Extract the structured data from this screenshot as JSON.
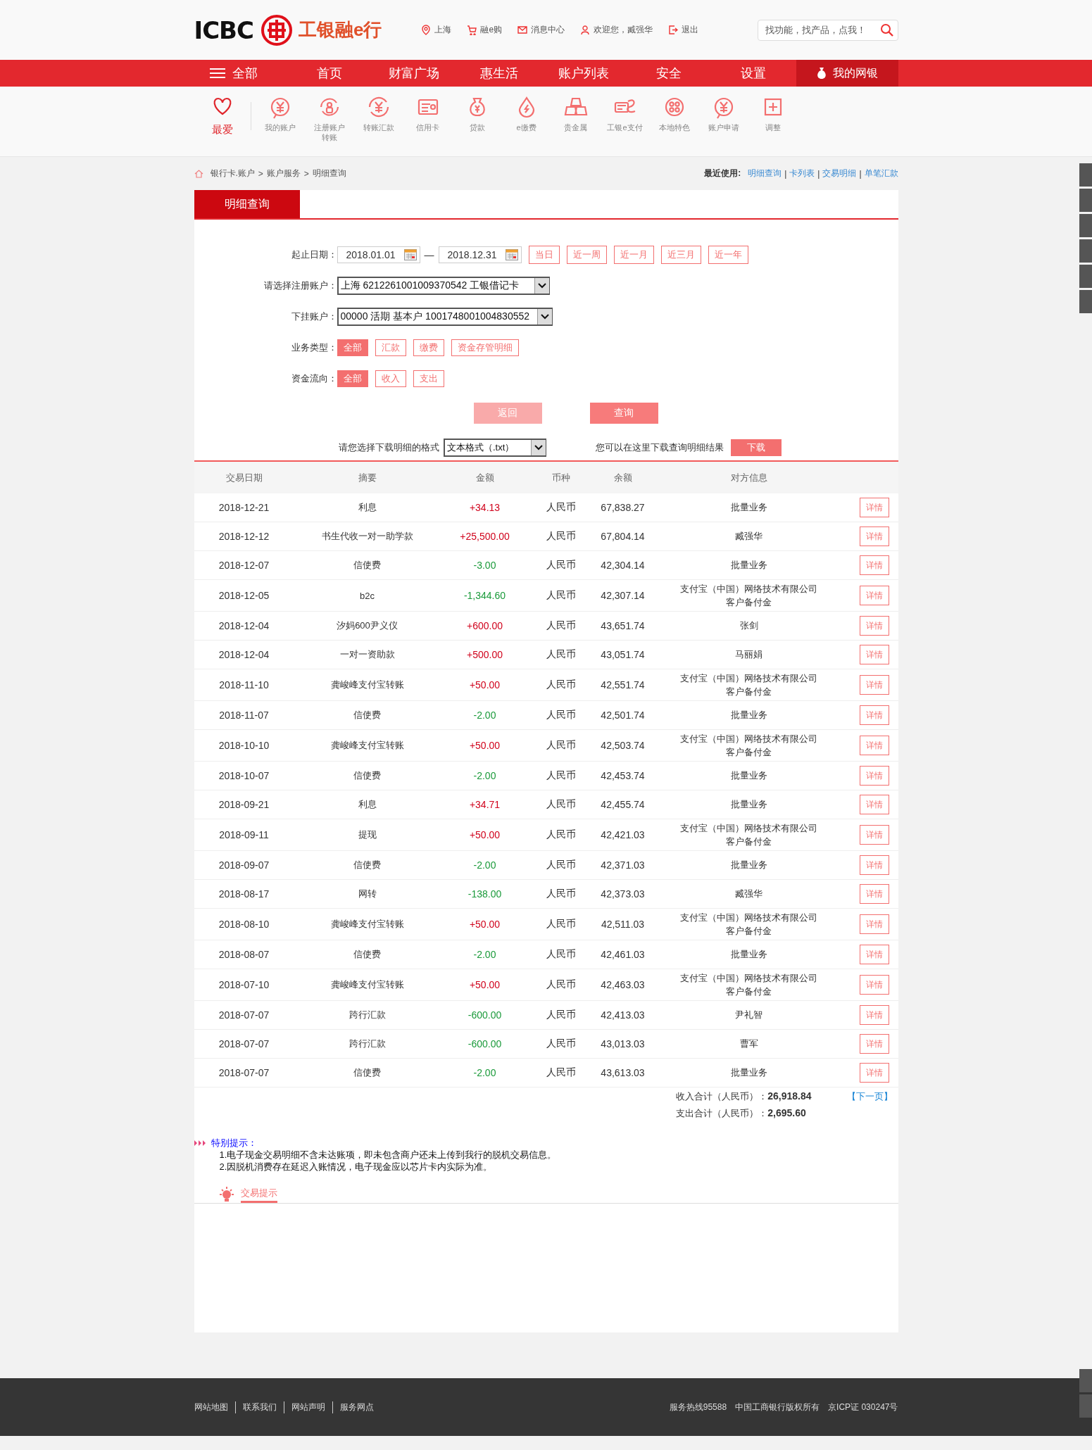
{
  "header": {
    "logo": "ICBC",
    "brand": "工银融e行",
    "top_links": [
      "上海",
      "融e购",
      "消息中心",
      "欢迎您，臧强华",
      "退出"
    ],
    "search": {
      "placeholder": "找功能，找产品，点我！"
    }
  },
  "nav": {
    "menu": "全部",
    "items": [
      "首页",
      "财富广场",
      "惠生活",
      "账户列表",
      "安全",
      "设置"
    ],
    "my_bank": "我的网银"
  },
  "quick_icons": [
    {
      "label": "最爱",
      "selected": true
    },
    {
      "label": "我的账户",
      "selected": false
    },
    {
      "label": "注册账户转账",
      "selected": false
    },
    {
      "label": "转账汇款",
      "selected": false
    },
    {
      "label": "信用卡",
      "selected": false
    },
    {
      "label": "贷款",
      "selected": false
    },
    {
      "label": "e缴费",
      "selected": false
    },
    {
      "label": "贵金属",
      "selected": false
    },
    {
      "label": "工银e支付",
      "selected": false
    },
    {
      "label": "本地特色",
      "selected": false
    },
    {
      "label": "账户申请",
      "selected": false
    },
    {
      "label": "调整",
      "selected": false
    }
  ],
  "breadcrumb": {
    "items": [
      "银行卡.账户",
      "账户服务",
      "明细查询"
    ],
    "separator": ">"
  },
  "recent": {
    "label": "最近使用:",
    "links": [
      "明细查询",
      "卡列表",
      "交易明细",
      "单笔汇款"
    ],
    "separator": "|"
  },
  "tab": "明细查询",
  "form": {
    "date_label": "起止日期：",
    "start_date": "2018.01.01",
    "dash": "—",
    "end_date": "2018.12.31",
    "ranges": [
      "当日",
      "近一周",
      "近一月",
      "近三月",
      "近一年"
    ],
    "account_label": "请选择注册账户：",
    "account": "上海 6212261001009370542 工银借记卡",
    "sub_account_label": "下挂账户：",
    "sub_account": "00000 活期 基本户 1001748001004830552",
    "type_label": "业务类型：",
    "types": [
      {
        "label": "全部",
        "selected": true
      },
      {
        "label": "汇款",
        "selected": false
      },
      {
        "label": "缴费",
        "selected": false
      },
      {
        "label": "资金存管明细",
        "selected": false
      }
    ],
    "flow_label": "资金流向：",
    "flows": [
      {
        "label": "全部",
        "selected": true
      },
      {
        "label": "收入",
        "selected": false
      },
      {
        "label": "支出",
        "selected": false
      }
    ],
    "buttons": [
      {
        "label": "返回",
        "disabled": true
      },
      {
        "label": "查询",
        "disabled": false
      }
    ]
  },
  "download": {
    "label": "请您选择下载明细的格式",
    "format": "文本格式（.txt）",
    "hint": "您可以在这里下载查询明细结果",
    "button": "下载"
  },
  "table": {
    "columns": [
      "交易日期",
      "摘要",
      "金额",
      "币种",
      "余额",
      "对方信息"
    ],
    "rows": [
      {
        "date": "2018-12-21",
        "summary": "利息",
        "amount": "+34.13",
        "income": true,
        "currency": "人民币",
        "balance": "67,838.27",
        "counterparty": "批量业务",
        "action": "详情"
      },
      {
        "date": "2018-12-12",
        "summary": "书生代收一对一助学款",
        "amount": "+25,500.00",
        "income": true,
        "currency": "人民币",
        "balance": "67,804.14",
        "counterparty": "臧强华",
        "action": "详情"
      },
      {
        "date": "2018-12-07",
        "summary": "信使费",
        "amount": "-3.00",
        "income": false,
        "currency": "人民币",
        "balance": "42,304.14",
        "counterparty": "批量业务",
        "action": "详情"
      },
      {
        "date": "2018-12-05",
        "summary": "b2c",
        "amount": "-1,344.60",
        "income": false,
        "currency": "人民币",
        "balance": "42,307.14",
        "counterparty": "支付宝（中国）网络技术有限公司客户备付金",
        "action": "详情"
      },
      {
        "date": "2018-12-04",
        "summary": "汐妈600尹义仪",
        "amount": "+600.00",
        "income": true,
        "currency": "人民币",
        "balance": "43,651.74",
        "counterparty": "张剑",
        "action": "详情"
      },
      {
        "date": "2018-12-04",
        "summary": "一对一资助款",
        "amount": "+500.00",
        "income": true,
        "currency": "人民币",
        "balance": "43,051.74",
        "counterparty": "马丽娟",
        "action": "详情"
      },
      {
        "date": "2018-11-10",
        "summary": "龚峻峰支付宝转账",
        "amount": "+50.00",
        "income": true,
        "currency": "人民币",
        "balance": "42,551.74",
        "counterparty": "支付宝（中国）网络技术有限公司客户备付金",
        "action": "详情"
      },
      {
        "date": "2018-11-07",
        "summary": "信使费",
        "amount": "-2.00",
        "income": false,
        "currency": "人民币",
        "balance": "42,501.74",
        "counterparty": "批量业务",
        "action": "详情"
      },
      {
        "date": "2018-10-10",
        "summary": "龚峻峰支付宝转账",
        "amount": "+50.00",
        "income": true,
        "currency": "人民币",
        "balance": "42,503.74",
        "counterparty": "支付宝（中国）网络技术有限公司客户备付金",
        "action": "详情"
      },
      {
        "date": "2018-10-07",
        "summary": "信使费",
        "amount": "-2.00",
        "income": false,
        "currency": "人民币",
        "balance": "42,453.74",
        "counterparty": "批量业务",
        "action": "详情"
      },
      {
        "date": "2018-09-21",
        "summary": "利息",
        "amount": "+34.71",
        "income": true,
        "currency": "人民币",
        "balance": "42,455.74",
        "counterparty": "批量业务",
        "action": "详情"
      },
      {
        "date": "2018-09-11",
        "summary": "提现",
        "amount": "+50.00",
        "income": true,
        "currency": "人民币",
        "balance": "42,421.03",
        "counterparty": "支付宝（中国）网络技术有限公司客户备付金",
        "action": "详情"
      },
      {
        "date": "2018-09-07",
        "summary": "信使费",
        "amount": "-2.00",
        "income": false,
        "currency": "人民币",
        "balance": "42,371.03",
        "counterparty": "批量业务",
        "action": "详情"
      },
      {
        "date": "2018-08-17",
        "summary": "网转",
        "amount": "-138.00",
        "income": false,
        "currency": "人民币",
        "balance": "42,373.03",
        "counterparty": "臧强华",
        "action": "详情"
      },
      {
        "date": "2018-08-10",
        "summary": "龚峻峰支付宝转账",
        "amount": "+50.00",
        "income": true,
        "currency": "人民币",
        "balance": "42,511.03",
        "counterparty": "支付宝（中国）网络技术有限公司客户备付金",
        "action": "详情"
      },
      {
        "date": "2018-08-07",
        "summary": "信使费",
        "amount": "-2.00",
        "income": false,
        "currency": "人民币",
        "balance": "42,461.03",
        "counterparty": "批量业务",
        "action": "详情"
      },
      {
        "date": "2018-07-10",
        "summary": "龚峻峰支付宝转账",
        "amount": "+50.00",
        "income": true,
        "currency": "人民币",
        "balance": "42,463.03",
        "counterparty": "支付宝（中国）网络技术有限公司客户备付金",
        "action": "详情"
      },
      {
        "date": "2018-07-07",
        "summary": "跨行汇款",
        "amount": "-600.00",
        "income": false,
        "currency": "人民币",
        "balance": "42,413.03",
        "counterparty": "尹礼智",
        "action": "详情"
      },
      {
        "date": "2018-07-07",
        "summary": "跨行汇款",
        "amount": "-600.00",
        "income": false,
        "currency": "人民币",
        "balance": "43,013.03",
        "counterparty": "曹军",
        "action": "详情"
      },
      {
        "date": "2018-07-07",
        "summary": "信使费",
        "amount": "-2.00",
        "income": false,
        "currency": "人民币",
        "balance": "43,613.03",
        "counterparty": "批量业务",
        "action": "详情"
      }
    ]
  },
  "totals": [
    {
      "label": "收入合计（人民币）：",
      "value": "26,918.84"
    },
    {
      "label": "支出合计（人民币）：",
      "value": "2,695.60"
    }
  ],
  "next_page": "【下一页】",
  "notice": {
    "title": "特别提示：",
    "lines": [
      "1.电子现金交易明细不含未达账项，即未包含商户还未上传到我行的脱机交易信息。",
      "2.因脱机消费存在延迟入账情况，电子现金应以芯片卡内实际为准。"
    ]
  },
  "tip_tab": "交易提示",
  "footer": {
    "links": [
      "网站地图",
      "联系我们",
      "网站声明",
      "服务网点"
    ],
    "info": [
      "服务热线95588",
      "中国工商银行版权所有",
      "京ICP证 030247号"
    ]
  }
}
